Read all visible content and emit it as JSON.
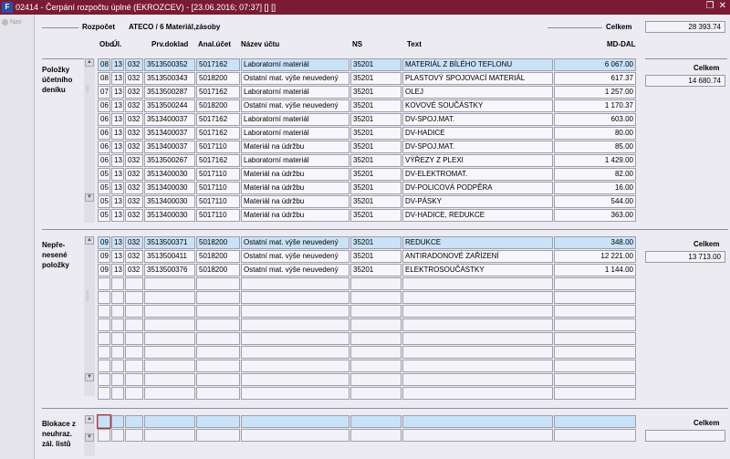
{
  "window": {
    "title": "02414 - Čerpání rozpočtu úplné (EKROZCEV) - [23.06.2016; 07:37] [] []",
    "icon": "app-icon"
  },
  "nav": {
    "label": "Nav"
  },
  "header": {
    "rozpocet_label": "Rozpočet",
    "rozpocet_value": "ATECO / 6 Materiál,zásoby",
    "celkem_label": "Celkem",
    "celkem_value": "28 393.74"
  },
  "columns": [
    "Obd.",
    "Úl.",
    "Prv.doklad",
    "Anal.účet",
    "Název účtu",
    "NS",
    "Text",
    "MD-DAL"
  ],
  "sections": {
    "posted": {
      "label": "Položky účetního deníku",
      "celkem_label": "Celkem",
      "celkem_value": "14 680.74",
      "rows": [
        [
          "08",
          "13",
          "032",
          "3513500352",
          "5017162",
          "Laboratorní materiál",
          "35201",
          "MATERIÁL Z BÍLÉHO TEFLONU",
          "6 067.00"
        ],
        [
          "08",
          "13",
          "032",
          "3513500343",
          "5018200",
          "Ostatní mat. výše neuvedený",
          "35201",
          "PLASTOVÝ SPOJOVACÍ MATERIÁL",
          "617.37"
        ],
        [
          "07",
          "13",
          "032",
          "3513500287",
          "5017162",
          "Laboratorní materiál",
          "35201",
          "OLEJ",
          "1 257.00"
        ],
        [
          "06",
          "13",
          "032",
          "3513500244",
          "5018200",
          "Ostatní mat. výše neuvedený",
          "35201",
          "KOVOVÉ SOUČÁSTKY",
          "1 170.37"
        ],
        [
          "06",
          "13",
          "032",
          "3513400037",
          "5017162",
          "Laboratorní materiál",
          "35201",
          "DV-SPOJ.MAT.",
          "603.00"
        ],
        [
          "06",
          "13",
          "032",
          "3513400037",
          "5017162",
          "Laboratorní materiál",
          "35201",
          "DV-HADICE",
          "80.00"
        ],
        [
          "06",
          "13",
          "032",
          "3513400037",
          "5017110",
          "Materiál na údržbu",
          "35201",
          "DV-SPOJ.MAT.",
          "85.00"
        ],
        [
          "06",
          "13",
          "032",
          "3513500267",
          "5017162",
          "Laboratorní materiál",
          "35201",
          "VÝŘEZY Z PLEXI",
          "1 429.00"
        ],
        [
          "05",
          "13",
          "032",
          "3513400030",
          "5017110",
          "Materiál na údržbu",
          "35201",
          "DV-ELEKTROMAT.",
          "82.00"
        ],
        [
          "05",
          "13",
          "032",
          "3513400030",
          "5017110",
          "Materiál na údržbu",
          "35201",
          "DV-POLICOVÁ PODPĚRA",
          "16.00"
        ],
        [
          "05",
          "13",
          "032",
          "3513400030",
          "5017110",
          "Materiál na údržbu",
          "35201",
          "DV-PÁSKY",
          "544.00"
        ],
        [
          "05",
          "13",
          "032",
          "3513400030",
          "5017110",
          "Materiál na údržbu",
          "35201",
          "DV-HADICE, REDUKCE",
          "363.00"
        ]
      ]
    },
    "unposted": {
      "label": "Nepře-nesené položky",
      "celkem_label": "Celkem",
      "celkem_value": "13 713.00",
      "rows": [
        [
          "09",
          "13",
          "032",
          "3513500371",
          "5018200",
          "Ostatní mat. výše neuvedený",
          "35201",
          "REDUKCE",
          "348.00"
        ],
        [
          "09",
          "13",
          "032",
          "3513500411",
          "5018200",
          "Ostatní mat. výše neuvedený",
          "35201",
          "ANTIRADONOVÉ ZAŘÍZENÍ",
          "12 221.00"
        ],
        [
          "09",
          "13",
          "032",
          "3513500376",
          "5018200",
          "Ostatní mat. výše neuvedený",
          "35201",
          "ELEKTROSOUČÁSTKY",
          "1 144.00"
        ]
      ],
      "empty_rows": 9
    },
    "blocked": {
      "label": "Blokace z neuhraz. zál. listů",
      "celkem_label": "Celkem",
      "celkem_value": "",
      "empty_rows": 2
    }
  },
  "colors": {
    "titlebar": "#7a1b33",
    "selected_row": "#c9e2f7",
    "background": "#ecebf2"
  }
}
